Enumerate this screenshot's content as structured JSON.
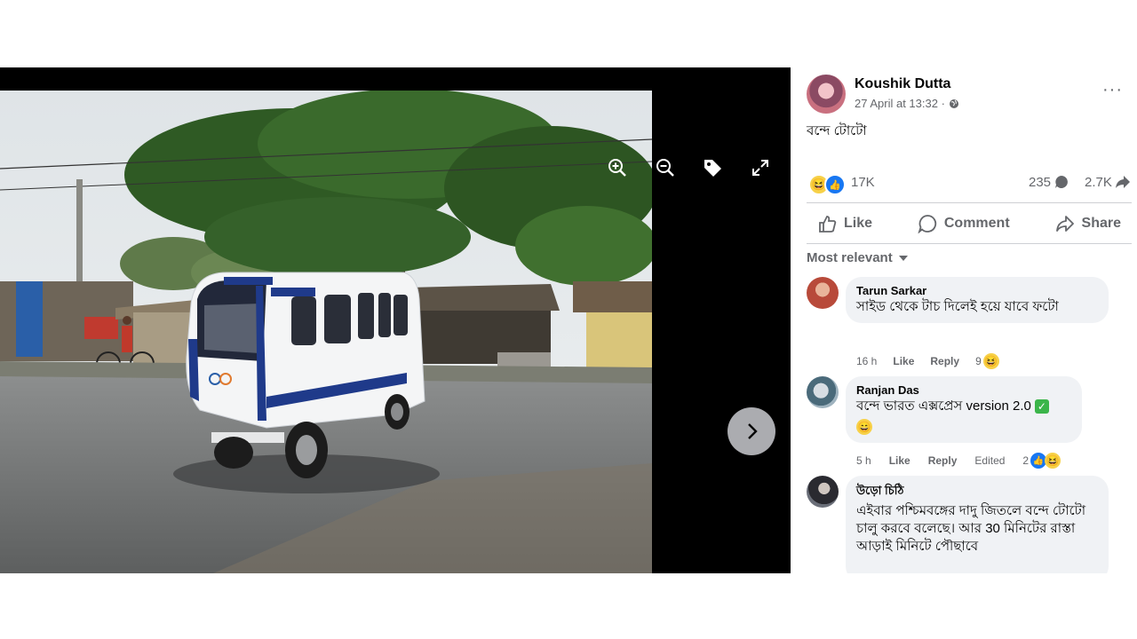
{
  "colors": {
    "accent": "#1877f2",
    "muted": "#65676b",
    "bubble": "#f0f2f5",
    "viewer_bg": "#000000"
  },
  "viewer": {
    "tools": [
      "zoom-in-icon",
      "zoom-out-icon",
      "tag-icon",
      "fullscreen-icon"
    ],
    "next_icon": "chevron-right-icon"
  },
  "post": {
    "author": "Koushik Dutta",
    "timestamp": "27 April at 13:32 ·",
    "privacy_icon": "globe-icon",
    "caption": "বন্দে টোটো",
    "more": "···"
  },
  "stats": {
    "reactions": "17K",
    "comments": "235",
    "shares": "2.7K"
  },
  "actions": {
    "like": "Like",
    "comment": "Comment",
    "share": "Share"
  },
  "sort_label": "Most relevant",
  "comments": [
    {
      "name": "Tarun Sarkar",
      "text": "সাইড থেকে টাচ দিলেই হয়ে যাবে ফটো",
      "time": "16 h",
      "like": "Like",
      "reply": "Reply",
      "reactions": "9"
    },
    {
      "name": "Ranjan Das",
      "text": "বন্দে ভারত এক্সপ্রেস version 2.0",
      "time": "5 h",
      "like": "Like",
      "reply": "Reply",
      "edited": "Edited",
      "reactions": "2"
    },
    {
      "name": "উড়ো চিঠি",
      "text": "এইবার পশ্চিমবঙ্গের দাদু জিতলে বন্দে টোটো চালু করবে বলেছে। আর 30 মিনিটের রাস্তা আড়াই মিনিটে পৌছাবে"
    }
  ]
}
